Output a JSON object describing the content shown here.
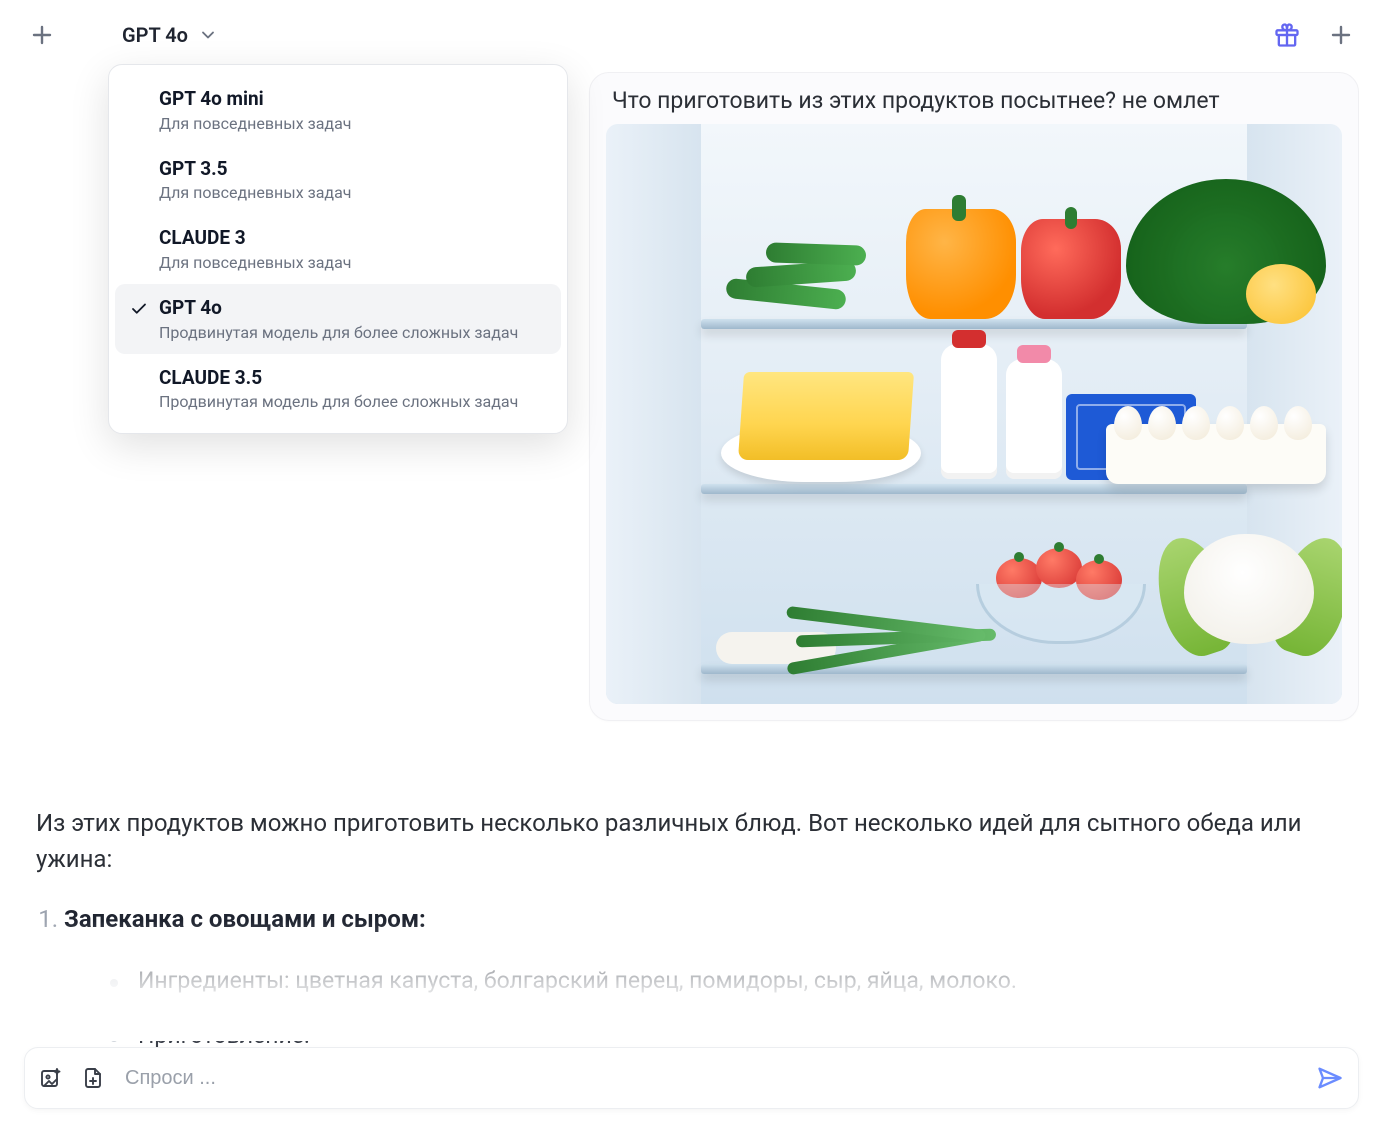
{
  "header": {
    "selected_model": "GPT 4o"
  },
  "model_dropdown": {
    "items": [
      {
        "title": "GPT 4o mini",
        "subtitle": "Для повседневных задач",
        "selected": false
      },
      {
        "title": "GPT 3.5",
        "subtitle": "Для повседневных задач",
        "selected": false
      },
      {
        "title": "CLAUDE 3",
        "subtitle": "Для повседневных задач",
        "selected": false
      },
      {
        "title": "GPT 4o",
        "subtitle": "Продвинутая модель для более сложных задач",
        "selected": true
      },
      {
        "title": "CLAUDE 3.5",
        "subtitle": "Продвинутая модель для более сложных задач",
        "selected": false
      }
    ]
  },
  "conversation": {
    "user_message": "Что приготовить из этих продуктов посытнее? не омлет",
    "assistant_intro": "Из этих продуктов можно приготовить несколько различных блюд. Вот несколько идей для сытного обеда или ужина:",
    "recipes": [
      {
        "number": "1.",
        "title": "Запеканка с овощами и сыром:",
        "bullets": [
          "Ингредиенты: цветная капуста, болгарский перец, помидоры, сыр, яйца, молоко.",
          "Приготовление:"
        ]
      }
    ]
  },
  "composer": {
    "placeholder": "Спроси ..."
  }
}
